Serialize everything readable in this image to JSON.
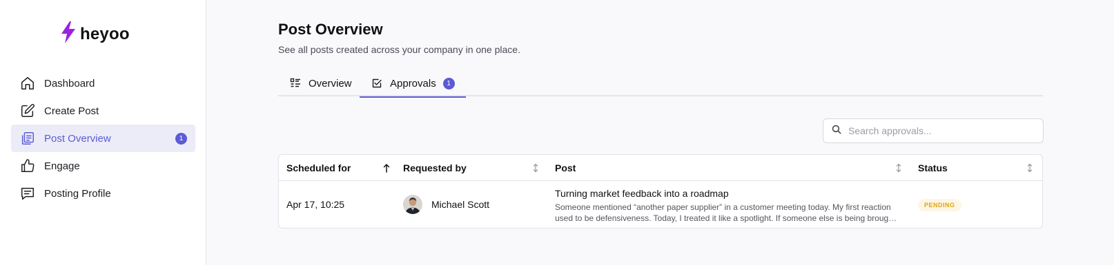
{
  "brand": {
    "name": "heyoo",
    "logo_color": "#9b22e0"
  },
  "sidebar": {
    "items": [
      {
        "label": "Dashboard",
        "icon": "home-icon"
      },
      {
        "label": "Create Post",
        "icon": "pencil-square-icon"
      },
      {
        "label": "Post Overview",
        "icon": "documents-icon",
        "active": true,
        "badge": "1"
      },
      {
        "label": "Engage",
        "icon": "thumbs-up-icon"
      },
      {
        "label": "Posting Profile",
        "icon": "message-square-icon"
      }
    ]
  },
  "header": {
    "title": "Post Overview",
    "subtitle": "See all posts created across your company in one place."
  },
  "tabs": [
    {
      "label": "Overview",
      "icon": "list-icon"
    },
    {
      "label": "Approvals",
      "icon": "checkbox-icon",
      "active": true,
      "badge": "1"
    }
  ],
  "search": {
    "placeholder": "Search approvals...",
    "value": ""
  },
  "table": {
    "columns": [
      "Scheduled for",
      "Requested by",
      "Post",
      "Status"
    ],
    "rows": [
      {
        "scheduled_for": "Apr 17, 10:25",
        "requested_by": "Michael Scott",
        "post_title": "Turning market feedback into a roadmap",
        "post_snippet_line1": "Someone mentioned “another paper supplier” in a customer meeting today. My first reaction",
        "post_snippet_line2": "used to be defensiveness. Today, I treated it like a spotlight. If someone else is being broug…",
        "status": "PENDING"
      }
    ]
  },
  "colors": {
    "accent": "#5b5bd6",
    "pending": "#e0a31a",
    "active_bg": "#ececf8"
  }
}
